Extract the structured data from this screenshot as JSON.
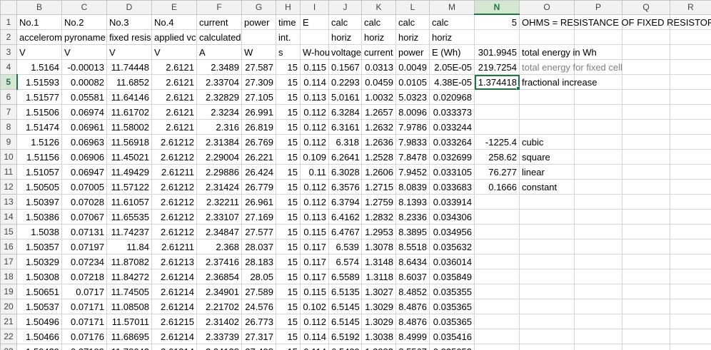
{
  "columns": [
    "B",
    "C",
    "D",
    "E",
    "F",
    "G",
    "H",
    "I",
    "J",
    "K",
    "L",
    "M",
    "N",
    "O",
    "P",
    "Q",
    "R"
  ],
  "selected_column": "N",
  "selected_row": 5,
  "rows": [
    {
      "n": "1",
      "c": [
        "No.1",
        "No.2",
        "No.3",
        "No.4",
        "current",
        "power",
        "time",
        "E",
        "calc",
        "calc",
        "calc",
        "calc",
        "5",
        "OHMS = RESISTANCE OF FIXED RESISTOR",
        "",
        "",
        ""
      ]
    },
    {
      "n": "2",
      "c": [
        "accelerom",
        "pyroname",
        "fixed resis",
        "applied vc",
        "calculated",
        "",
        "int.",
        "",
        "horiz",
        "horiz",
        "horiz",
        "horiz",
        "",
        "",
        "",
        "",
        ""
      ]
    },
    {
      "n": "3",
      "c": [
        "V",
        "V",
        "V",
        "V",
        "A",
        "W",
        "s",
        "W-hou",
        "voltage",
        "current",
        "power",
        "E (Wh)",
        "301.9945",
        "total energy in Wh",
        "",
        "",
        ""
      ]
    },
    {
      "n": "4",
      "c": [
        "1.5164",
        "-0.00013",
        "11.74448",
        "2.6121",
        "2.3489",
        "27.587",
        "15",
        "0.115",
        "0.1567",
        "0.0313",
        "0.0049",
        "2.05E-05",
        "219.7254",
        "total energy for fixed cell",
        "",
        "",
        ""
      ]
    },
    {
      "n": "5",
      "c": [
        "1.51593",
        "0.00082",
        "11.6852",
        "2.6121",
        "2.33704",
        "27.309",
        "15",
        "0.114",
        "0.2293",
        "0.0459",
        "0.0105",
        "4.38E-05",
        "1.374418",
        "fractional increase",
        "",
        "",
        ""
      ]
    },
    {
      "n": "6",
      "c": [
        "1.51577",
        "0.05581",
        "11.64146",
        "2.6121",
        "2.32829",
        "27.105",
        "15",
        "0.113",
        "5.0161",
        "1.0032",
        "5.0323",
        "0.020968",
        "",
        "",
        "",
        "",
        ""
      ]
    },
    {
      "n": "7",
      "c": [
        "1.51506",
        "0.06974",
        "11.61702",
        "2.6121",
        "2.3234",
        "26.991",
        "15",
        "0.112",
        "6.3284",
        "1.2657",
        "8.0096",
        "0.033373",
        "",
        "",
        "",
        "",
        ""
      ]
    },
    {
      "n": "8",
      "c": [
        "1.51474",
        "0.06961",
        "11.58002",
        "2.6121",
        "2.316",
        "26.819",
        "15",
        "0.112",
        "6.3161",
        "1.2632",
        "7.9786",
        "0.033244",
        "",
        "",
        "",
        "",
        ""
      ]
    },
    {
      "n": "9",
      "c": [
        "1.5126",
        "0.06963",
        "11.56918",
        "2.61212",
        "2.31384",
        "26.769",
        "15",
        "0.112",
        "6.318",
        "1.2636",
        "7.9833",
        "0.033264",
        "-1225.4",
        "cubic",
        "",
        "",
        ""
      ]
    },
    {
      "n": "10",
      "c": [
        "1.51156",
        "0.06906",
        "11.45021",
        "2.61212",
        "2.29004",
        "26.221",
        "15",
        "0.109",
        "6.2641",
        "1.2528",
        "7.8478",
        "0.032699",
        "258.62",
        "square",
        "",
        "",
        ""
      ]
    },
    {
      "n": "11",
      "c": [
        "1.51057",
        "0.06947",
        "11.49429",
        "2.61211",
        "2.29886",
        "26.424",
        "15",
        "0.11",
        "6.3028",
        "1.2606",
        "7.9452",
        "0.033105",
        "76.277",
        "linear",
        "",
        "",
        ""
      ]
    },
    {
      "n": "12",
      "c": [
        "1.50505",
        "0.07005",
        "11.57122",
        "2.61212",
        "2.31424",
        "26.779",
        "15",
        "0.112",
        "6.3576",
        "1.2715",
        "8.0839",
        "0.033683",
        "0.1666",
        "constant",
        "",
        "",
        ""
      ]
    },
    {
      "n": "13",
      "c": [
        "1.50397",
        "0.07028",
        "11.61057",
        "2.61212",
        "2.32211",
        "26.961",
        "15",
        "0.112",
        "6.3794",
        "1.2759",
        "8.1393",
        "0.033914",
        "",
        "",
        "",
        "",
        ""
      ]
    },
    {
      "n": "14",
      "c": [
        "1.50386",
        "0.07067",
        "11.65535",
        "2.61212",
        "2.33107",
        "27.169",
        "15",
        "0.113",
        "6.4162",
        "1.2832",
        "8.2336",
        "0.034306",
        "",
        "",
        "",
        "",
        ""
      ]
    },
    {
      "n": "15",
      "c": [
        "1.5038",
        "0.07131",
        "11.74237",
        "2.61212",
        "2.34847",
        "27.577",
        "15",
        "0.115",
        "6.4767",
        "1.2953",
        "8.3895",
        "0.034956",
        "",
        "",
        "",
        "",
        ""
      ]
    },
    {
      "n": "16",
      "c": [
        "1.50357",
        "0.07197",
        "11.84",
        "2.61211",
        "2.368",
        "28.037",
        "15",
        "0.117",
        "6.539",
        "1.3078",
        "8.5518",
        "0.035632",
        "",
        "",
        "",
        "",
        ""
      ]
    },
    {
      "n": "17",
      "c": [
        "1.50329",
        "0.07234",
        "11.87082",
        "2.61213",
        "2.37416",
        "28.183",
        "15",
        "0.117",
        "6.574",
        "1.3148",
        "8.6434",
        "0.036014",
        "",
        "",
        "",
        "",
        ""
      ]
    },
    {
      "n": "18",
      "c": [
        "1.50308",
        "0.07218",
        "11.84272",
        "2.61214",
        "2.36854",
        "28.05",
        "15",
        "0.117",
        "6.5589",
        "1.3118",
        "8.6037",
        "0.035849",
        "",
        "",
        "",
        "",
        ""
      ]
    },
    {
      "n": "19",
      "c": [
        "1.50651",
        "0.0717",
        "11.74505",
        "2.61214",
        "2.34901",
        "27.589",
        "15",
        "0.115",
        "6.5135",
        "1.3027",
        "8.4852",
        "0.035355",
        "",
        "",
        "",
        "",
        ""
      ]
    },
    {
      "n": "20",
      "c": [
        "1.50537",
        "0.07171",
        "11.08508",
        "2.61214",
        "2.21702",
        "24.576",
        "15",
        "0.102",
        "6.5145",
        "1.3029",
        "8.4876",
        "0.035365",
        "",
        "",
        "",
        "",
        ""
      ]
    },
    {
      "n": "21",
      "c": [
        "1.50496",
        "0.07171",
        "11.57011",
        "2.61215",
        "2.31402",
        "26.773",
        "15",
        "0.112",
        "6.5145",
        "1.3029",
        "8.4876",
        "0.035365",
        "",
        "",
        "",
        "",
        ""
      ]
    },
    {
      "n": "22",
      "c": [
        "1.50466",
        "0.07176",
        "11.68695",
        "2.61214",
        "2.33739",
        "27.317",
        "15",
        "0.114",
        "6.5192",
        "1.3038",
        "8.4999",
        "0.035416",
        "",
        "",
        "",
        "",
        ""
      ]
    },
    {
      "n": "23",
      "c": [
        "1.50439",
        "0.07199",
        "11.70642",
        "2.61214",
        "2.34128",
        "27.408",
        "15",
        "0.114",
        "6.5409",
        "1.3082",
        "8.5567",
        "0.035653",
        "",
        "",
        "",
        "",
        ""
      ]
    }
  ]
}
